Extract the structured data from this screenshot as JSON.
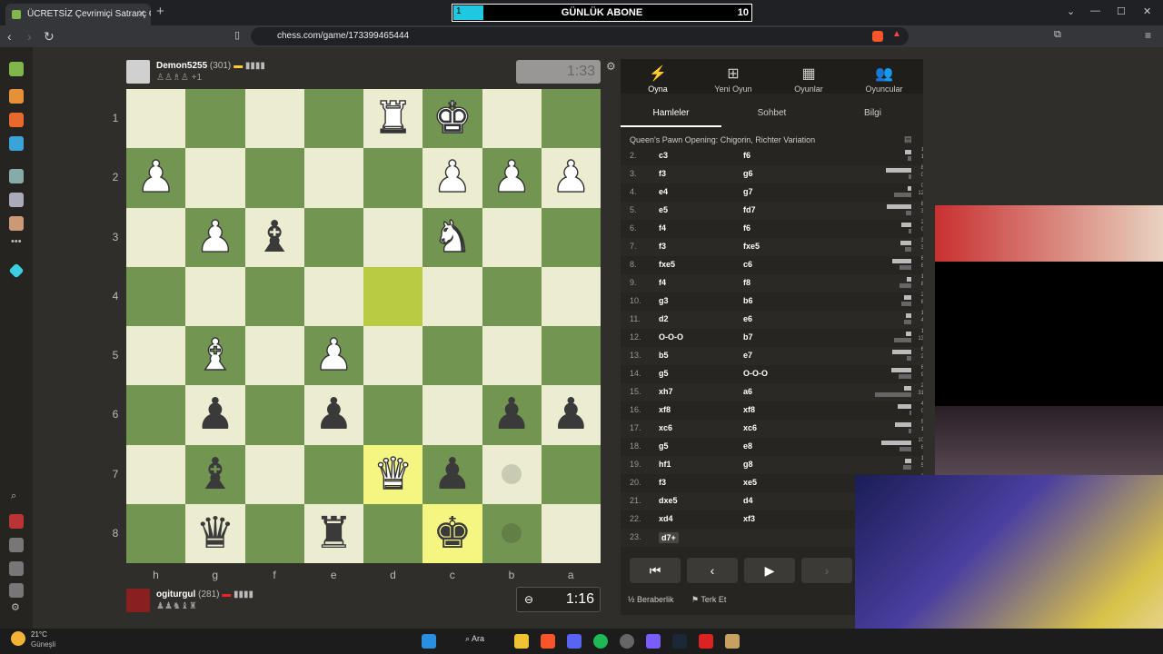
{
  "browser": {
    "tab_title": "ÜCRETSİZ Çevrimiçi Satranç Oyn",
    "url": "chess.com/game/173399465444"
  },
  "overlay": {
    "label": "GÜNLÜK ABONE",
    "current": "1",
    "goal": "10",
    "progress": 0.1
  },
  "top_player": {
    "name": "Demon5255",
    "rating": "(301)",
    "captured": "+1",
    "clock": "1:33"
  },
  "bottom_player": {
    "name": "ogiturgul",
    "rating": "(281)",
    "clock": "1:16"
  },
  "board": {
    "ranks": [
      "1",
      "2",
      "3",
      "4",
      "5",
      "6",
      "7",
      "8"
    ],
    "files": [
      "h",
      "g",
      "f",
      "e",
      "d",
      "c",
      "b",
      "a"
    ]
  },
  "panel": {
    "top_tabs": [
      "Oyna",
      "Yeni Oyun",
      "Oyunlar",
      "Oyuncular"
    ],
    "move_tabs": [
      "Hamleler",
      "Sohbet",
      "Bilgi"
    ],
    "opening": "Queen's Pawn Opening: Chigorin, Richter Variation",
    "moves": [
      {
        "n": "2.",
        "w": "c3",
        "b": "f6"
      },
      {
        "n": "3.",
        "w": "f3",
        "b": "g6"
      },
      {
        "n": "4.",
        "w": "e4",
        "b": "g7"
      },
      {
        "n": "5.",
        "w": "e5",
        "b": "fd7"
      },
      {
        "n": "6.",
        "w": "f4",
        "b": "f6"
      },
      {
        "n": "7.",
        "w": "f3",
        "b": "fxe5"
      },
      {
        "n": "8.",
        "w": "fxe5",
        "b": "c6"
      },
      {
        "n": "9.",
        "w": "f4",
        "b": "f8"
      },
      {
        "n": "10.",
        "w": "g3",
        "b": "b6"
      },
      {
        "n": "11.",
        "w": "d2",
        "b": "e6"
      },
      {
        "n": "12.",
        "w": "O-O-O",
        "b": "b7"
      },
      {
        "n": "13.",
        "w": "b5",
        "b": "e7"
      },
      {
        "n": "14.",
        "w": "g5",
        "b": "O-O-O"
      },
      {
        "n": "15.",
        "w": "xh7",
        "b": "a6"
      },
      {
        "n": "16.",
        "w": "xf8",
        "b": "xf8"
      },
      {
        "n": "17.",
        "w": "xc6",
        "b": "xc6"
      },
      {
        "n": "18.",
        "w": "g5",
        "b": "e8"
      },
      {
        "n": "19.",
        "w": "hf1",
        "b": "g8"
      },
      {
        "n": "20.",
        "w": "f3",
        "b": "xe5"
      },
      {
        "n": "21.",
        "w": "dxe5",
        "b": "d4"
      },
      {
        "n": "22.",
        "w": "xd4",
        "b": "xf3"
      },
      {
        "n": "23.",
        "w": "d7+",
        "b": ""
      }
    ],
    "time_bars": [
      [
        "1.8s",
        "1.7s"
      ],
      [
        "8.7s",
        "0.7s"
      ],
      [
        "0.7s",
        "12.8s"
      ],
      [
        "8.2s",
        "3.4s"
      ],
      [
        "2.9s",
        "0.9s"
      ],
      [
        "3.3s",
        "3.7s"
      ],
      [
        "6.5s",
        "8.4s"
      ],
      [
        "1.0s",
        "8.4s"
      ],
      [
        "2.1s",
        "6.7s"
      ],
      [
        "1.5s",
        "4.9s"
      ],
      [
        "1.4s",
        "13.2s"
      ],
      [
        "6.3s",
        "2.5s"
      ],
      [
        "6.6s",
        "9.3s"
      ],
      [
        "2.1s",
        "31.8s"
      ],
      [
        "4.2s",
        "0.2s"
      ],
      [
        "5.5s",
        "1.0s"
      ],
      [
        "10.3s",
        "8.8s"
      ],
      [
        "1.8s",
        "5.5s"
      ],
      [
        "2.3s",
        "8.5s"
      ],
      [
        "",
        ""
      ],
      [
        "",
        ""
      ],
      [
        "",
        ""
      ]
    ],
    "draw_label": "Beraberlik",
    "resign_label": "Terk Et",
    "draw_fraction": "½"
  },
  "taskbar": {
    "temp": "21°C",
    "weather": "Güneşli",
    "search": "Ara"
  },
  "colors": {
    "light_sq": "#ebecd0",
    "dark_sq": "#739552",
    "highlight": "#f5f682",
    "accent": "#81b64c"
  }
}
